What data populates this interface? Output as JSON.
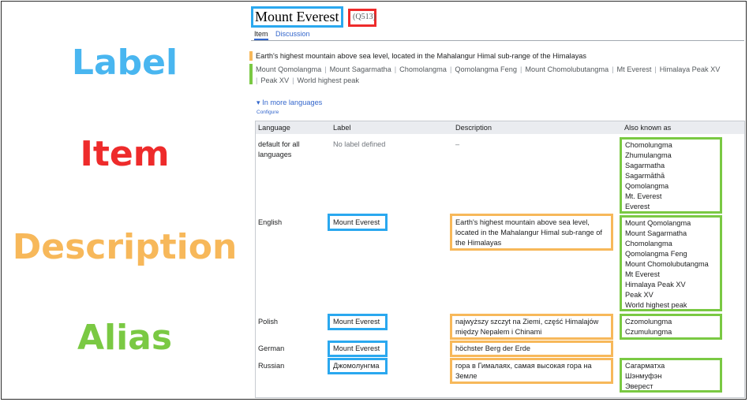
{
  "legend": {
    "label": "Label",
    "item": "Item",
    "description": "Description",
    "alias": "Alias"
  },
  "colors": {
    "label": "#49b6f0",
    "item": "#ee2b2b",
    "description": "#f7b85a",
    "alias": "#7ac943",
    "link": "#3366cc"
  },
  "page": {
    "title": "Mount Everest",
    "qid": "Q513",
    "tabs": [
      "Item",
      "Discussion"
    ],
    "description": "Earth's highest mountain above sea level, located in the Mahalangur Himal sub-range of the Himalayas",
    "aliases": [
      "Mount Qomolangma",
      "Mount Sagarmatha",
      "Chomolangma",
      "Qomolangma Feng",
      "Mount Chomolubutangma",
      "Mt Everest",
      "Himalaya Peak XV",
      "Peak XV",
      "World highest peak"
    ],
    "more_languages": "▾ In more languages",
    "configure": "Configure"
  },
  "table": {
    "headers": {
      "language": "Language",
      "label": "Label",
      "description": "Description",
      "aka": "Also known as"
    },
    "rows": [
      {
        "language": "default for all languages",
        "label": "No label defined",
        "description": "–",
        "aliases": [
          "Chomolungma",
          "Zhumulangma",
          "Sagarmatha",
          "Sagarmāthā",
          "Qomolangma",
          "Mt. Everest",
          "Everest"
        ]
      },
      {
        "language": "English",
        "label": "Mount Everest",
        "description": "Earth's highest mountain above sea level, located in the Mahalangur Himal sub-range of the Himalayas",
        "aliases": [
          "Mount Qomolangma",
          "Mount Sagarmatha",
          "Chomolangma",
          "Qomolangma Feng",
          "Mount Chomolubutangma",
          "Mt Everest",
          "Himalaya Peak XV",
          "Peak XV",
          "World highest peak"
        ]
      },
      {
        "language": "Polish",
        "label": "Mount Everest",
        "description": "najwyższy szczyt na Ziemi, część Himalajów między Nepalem i Chinami",
        "aliases": [
          "Czomolungma",
          "Czumulungma"
        ]
      },
      {
        "language": "German",
        "label": "Mount Everest",
        "description": "höchster Berg der Erde",
        "aliases": []
      },
      {
        "language": "Russian",
        "label": "Джомолунгма",
        "description": "гора в Гималаях, самая высокая гора на Земле",
        "aliases": [
          "Сагарматха",
          "Шэнмуфэн",
          "Эверест"
        ]
      }
    ]
  }
}
